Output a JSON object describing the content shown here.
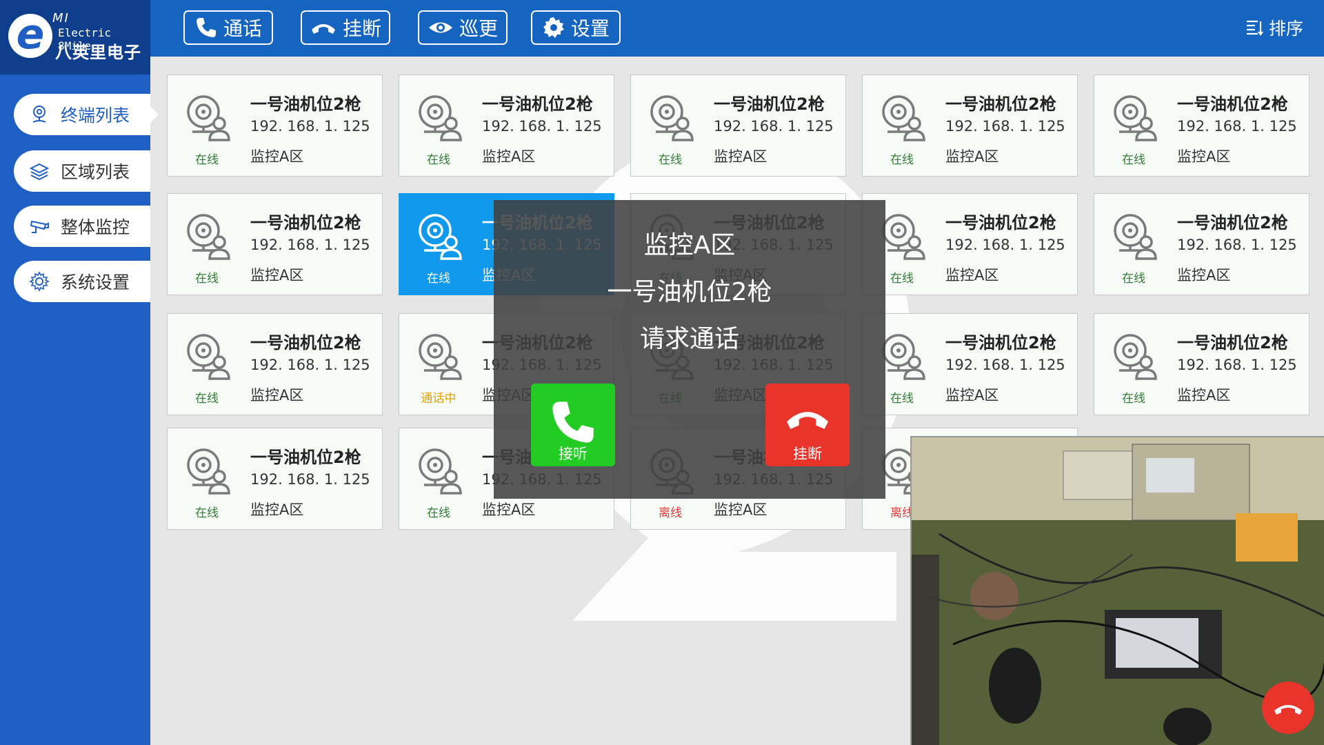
{
  "brand": {
    "logo_letter": "e",
    "logo_mi": "MI",
    "logo_en": "Electric 8Mile",
    "logo_cn": "八英里电子"
  },
  "sidebar": {
    "items": [
      {
        "label": "终端列表",
        "icon": "location-pin-icon",
        "active": true
      },
      {
        "label": "区域列表",
        "icon": "layers-icon",
        "active": false
      },
      {
        "label": "整体监控",
        "icon": "cctv-camera-icon",
        "active": false
      },
      {
        "label": "系统设置",
        "icon": "gear-icon",
        "active": false
      }
    ]
  },
  "toolbar": {
    "call_label": "通话",
    "hangup_label": "挂断",
    "patrol_label": "巡更",
    "settings_label": "设置",
    "sort_label": "排序"
  },
  "terminals": [
    {
      "title": "一号油机位2枪",
      "ip": "192. 168. 1. 125",
      "zone": "监控A区",
      "status": "在线"
    },
    {
      "title": "一号油机位2枪",
      "ip": "192. 168. 1. 125",
      "zone": "监控A区",
      "status": "在线"
    },
    {
      "title": "一号油机位2枪",
      "ip": "192. 168. 1. 125",
      "zone": "监控A区",
      "status": "在线"
    },
    {
      "title": "一号油机位2枪",
      "ip": "192. 168. 1. 125",
      "zone": "监控A区",
      "status": "在线"
    },
    {
      "title": "一号油机位2枪",
      "ip": "192. 168. 1. 125",
      "zone": "监控A区",
      "status": "在线"
    },
    {
      "title": "一号油机位2枪",
      "ip": "192. 168. 1. 125",
      "zone": "监控A区",
      "status": "在线"
    },
    {
      "title": "一号油机位2枪",
      "ip": "192. 168. 1. 125",
      "zone": "监控A区",
      "status": "在线",
      "selected": true
    },
    {
      "title": "一号油机位2枪",
      "ip": "192. 168. 1. 125",
      "zone": "监控A区",
      "status": "在线"
    },
    {
      "title": "一号油机位2枪",
      "ip": "192. 168. 1. 125",
      "zone": "监控A区",
      "status": "在线"
    },
    {
      "title": "一号油机位2枪",
      "ip": "192. 168. 1. 125",
      "zone": "监控A区",
      "status": "在线"
    },
    {
      "title": "一号油机位2枪",
      "ip": "192. 168. 1. 125",
      "zone": "监控A区",
      "status": "在线"
    },
    {
      "title": "一号油机位2枪",
      "ip": "192. 168. 1. 125",
      "zone": "监控A区",
      "status": "通话中"
    },
    {
      "title": "一号油机位2枪",
      "ip": "192. 168. 1. 125",
      "zone": "监控A区",
      "status": "在线"
    },
    {
      "title": "一号油机位2枪",
      "ip": "192. 168. 1. 125",
      "zone": "监控A区",
      "status": "在线"
    },
    {
      "title": "一号油机位2枪",
      "ip": "192. 168. 1. 125",
      "zone": "监控A区",
      "status": "在线"
    },
    {
      "title": "一号油机位2枪",
      "ip": "192. 168. 1. 125",
      "zone": "监控A区",
      "status": "在线"
    },
    {
      "title": "一号油机位2枪",
      "ip": "192. 168. 1. 125",
      "zone": "监控A区",
      "status": "在线"
    },
    {
      "title": "一号油机位2枪",
      "ip": "192. 168. 1. 125",
      "zone": "监控A区",
      "status": "离线"
    },
    {
      "title": "一号油机位2枪",
      "ip": "192. 168. 1. 125",
      "zone": "监控A区",
      "status": "离线"
    }
  ],
  "call_popup": {
    "zone": "监控A区",
    "terminal": "一号油机位2枪",
    "message": "请求通话",
    "answer_label": "接听",
    "hangup_label": "挂断"
  },
  "colors": {
    "sidebar": "#1f5fc4",
    "topbar": "#1565c0",
    "online": "#2e7d32",
    "calling": "#e6a000",
    "offline": "#e53935",
    "answer": "#22cc22",
    "hangup": "#e8342b",
    "selected": "#1199ee"
  }
}
